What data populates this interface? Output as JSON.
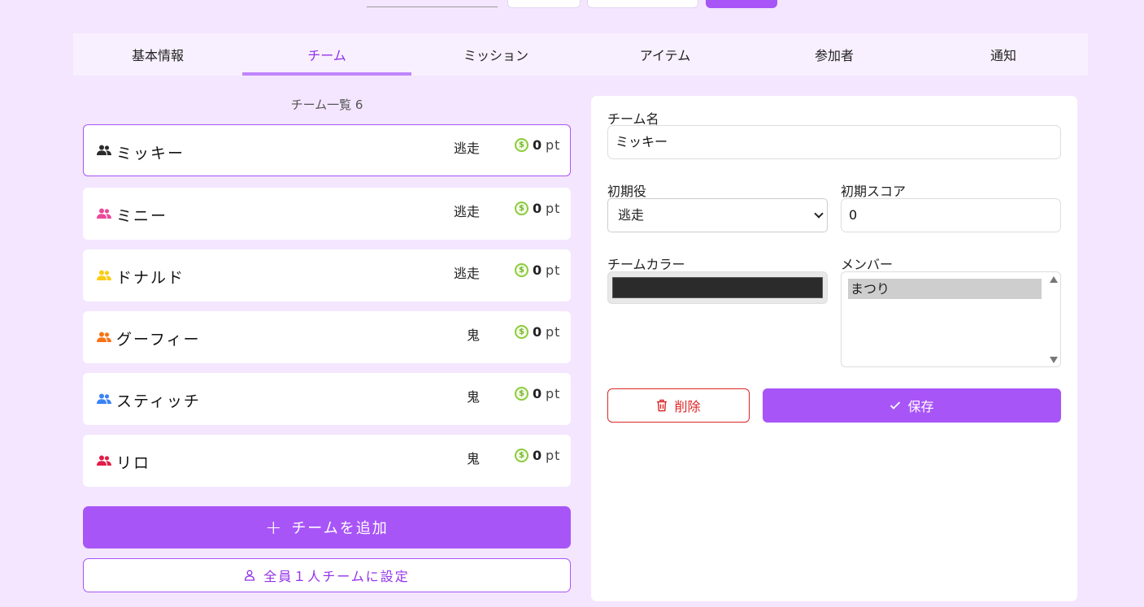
{
  "tabs": [
    {
      "label": "基本情報"
    },
    {
      "label": "チーム"
    },
    {
      "label": "ミッション"
    },
    {
      "label": "アイテム"
    },
    {
      "label": "参加者"
    },
    {
      "label": "通知"
    }
  ],
  "team_list": {
    "title": "チーム一覧 6",
    "teams": [
      {
        "name": "ミッキー",
        "role": "逃走",
        "score": "0",
        "unit": "pt",
        "color": "#2b2b2b"
      },
      {
        "name": "ミニー",
        "role": "逃走",
        "score": "0",
        "unit": "pt",
        "color": "#ec4899"
      },
      {
        "name": "ドナルド",
        "role": "逃走",
        "score": "0",
        "unit": "pt",
        "color": "#facc15"
      },
      {
        "name": "グーフィー",
        "role": "鬼",
        "score": "0",
        "unit": "pt",
        "color": "#f97316"
      },
      {
        "name": "スティッチ",
        "role": "鬼",
        "score": "0",
        "unit": "pt",
        "color": "#3b82f6"
      },
      {
        "name": "リロ",
        "role": "鬼",
        "score": "0",
        "unit": "pt",
        "color": "#e11d48"
      }
    ],
    "add_button": "チームを追加",
    "single_button": "全員１人チームに設定"
  },
  "editor": {
    "name_label": "チーム名",
    "name_value": "ミッキー",
    "role_label": "初期役",
    "role_value": "逃走",
    "score_label": "初期スコア",
    "score_value": "0",
    "color_label": "チームカラー",
    "color_value": "#2b2b2b",
    "members_label": "メンバー",
    "members": [
      "まつり"
    ],
    "delete_button": "削除",
    "save_button": "保存"
  }
}
